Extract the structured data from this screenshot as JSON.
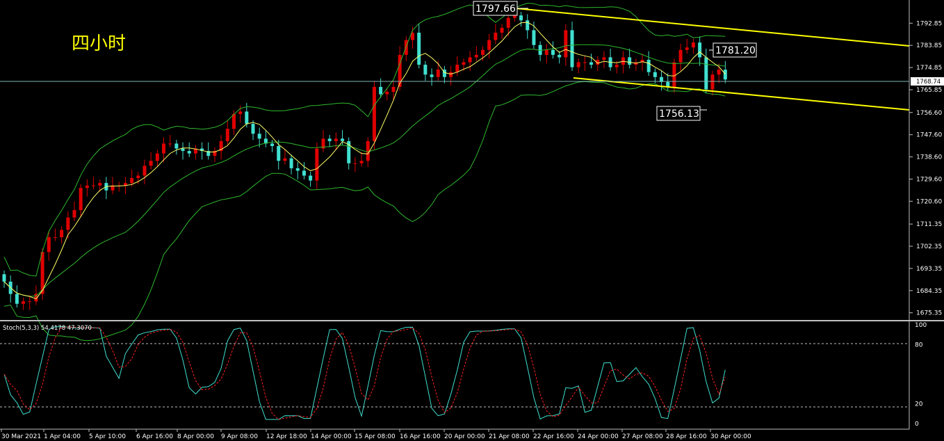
{
  "title": "四小时",
  "colors": {
    "background": "#000000",
    "bull_candle": "#e00000",
    "bear_candle": "#40e0d0",
    "bollinger": "#2eb82e",
    "ma": "#ffff66",
    "trendline": "#ffff00",
    "stoch_main": "#40e0d0",
    "stoch_signal": "#ff2020",
    "axis": "#c0c0c0"
  },
  "price_axis": {
    "ticks": [
      "1792.85",
      "1783.85",
      "1774.85",
      "1765.85",
      "1756.60",
      "1747.60",
      "1738.60",
      "1729.60",
      "1720.60",
      "1711.35",
      "1702.35",
      "1693.35",
      "1684.35",
      "1675.35"
    ],
    "current_price": "1768.74"
  },
  "time_axis": {
    "labels": [
      "30 Mar 2021",
      "1 Apr 04:00",
      "5 Apr 10:00",
      "6 Apr 16:00",
      "8 Apr 00:00",
      "9 Apr 08:00",
      "12 Apr 18:00",
      "14 Apr 00:00",
      "15 Apr 08:00",
      "16 Apr 16:00",
      "20 Apr 00:00",
      "21 Apr 08:00",
      "22 Apr 16:00",
      "24 Apr 00:00",
      "27 Apr 08:00",
      "28 Apr 16:00",
      "30 Apr 00:00"
    ]
  },
  "annotations": {
    "high": "1797.66",
    "mid": "1781.20",
    "low": "1756.13"
  },
  "indicator": {
    "label": "Stoch(5,3,3) 54.4178 47.3070",
    "ticks": [
      "100",
      "80",
      "20",
      "0"
    ]
  },
  "chart_data": {
    "type": "candlestick",
    "title": "四小时",
    "ylim": [
      1673,
      1800
    ],
    "closes": [
      1688,
      1683,
      1679,
      1680,
      1680,
      1683,
      1700,
      1706,
      1706,
      1709,
      1714,
      1717,
      1726,
      1727,
      1727,
      1728,
      1725,
      1727,
      1727,
      1728,
      1730,
      1731,
      1735,
      1737,
      1740,
      1744,
      1744,
      1742,
      1741,
      1740,
      1742,
      1741,
      1739,
      1741,
      1745,
      1750,
      1756,
      1757,
      1752,
      1748,
      1746,
      1744,
      1743,
      1737,
      1738,
      1734,
      1733,
      1731,
      1729,
      1742,
      1746,
      1745,
      1746,
      1745,
      1736,
      1736,
      1737,
      1745,
      1767,
      1764,
      1765,
      1767,
      1780,
      1786,
      1789,
      1776,
      1772,
      1771,
      1774,
      1771,
      1773,
      1776,
      1777,
      1779,
      1780,
      1782,
      1786,
      1789,
      1791,
      1795,
      1796,
      1794,
      1790,
      1784,
      1780,
      1782,
      1780,
      1779,
      1790,
      1775,
      1777,
      1777,
      1776,
      1778,
      1779,
      1775,
      1776,
      1779,
      1776,
      1777,
      1778,
      1773,
      1771,
      1769,
      1767,
      1777,
      1782,
      1783,
      1785,
      1779,
      1766,
      1772,
      1774,
      1770
    ],
    "stochastic": {
      "name": "Stoch(5,3,3)",
      "k_last": 54.4178,
      "d_last": 47.307,
      "levels": [
        80,
        20
      ],
      "ylim": [
        0,
        100
      ]
    }
  }
}
